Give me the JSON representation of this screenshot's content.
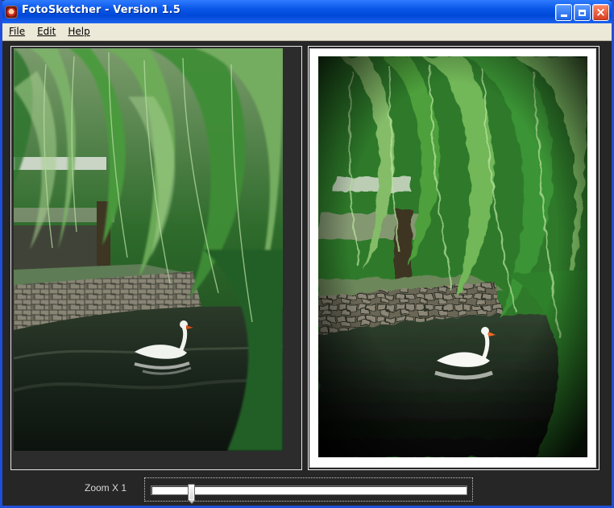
{
  "window": {
    "title": "FotoSketcher  -  Version 1.5",
    "buttons": {
      "minimize_icon": "minimize-icon",
      "maximize_icon": "maximize-icon",
      "close_icon": "close-icon",
      "close_symbol": "×"
    }
  },
  "menu": {
    "items": [
      "File",
      "Edit",
      "Help"
    ]
  },
  "images": {
    "original_alt": "",
    "processed_alt": ""
  },
  "zoom": {
    "label": "Zoom X 1",
    "slider_value": 0.12
  },
  "colors": {
    "title_bar": "#0a57e8",
    "menu_background": "#ece9d8",
    "workspace_background": "#262626",
    "panel_border": "#e5e5e5"
  }
}
